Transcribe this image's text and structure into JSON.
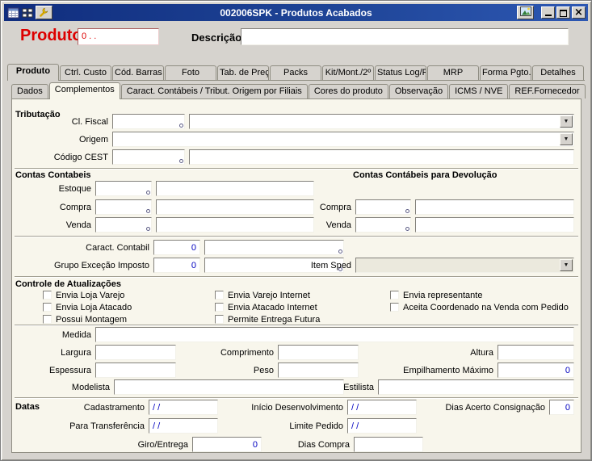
{
  "window": {
    "title": "002006SPK - Produtos Acabados"
  },
  "icons": {
    "close": "×",
    "dropdown_arrow": "▼"
  },
  "header": {
    "product_label": "Produto",
    "product_value": "0 . .",
    "description_label": "Descrição",
    "description_value": ""
  },
  "tabs_outer": [
    "Produto",
    "Ctrl. Custo",
    "Cód. Barras",
    "Foto",
    "Tab. de Preç",
    "Packs",
    "Kit/Mont./2º",
    "Status Log/F",
    "MRP",
    "Forma Pgto.",
    "Detalhes"
  ],
  "tabs_inner": [
    "Dados",
    "Complementos",
    "Caract. Contábeis / Tribut. Origem por Filiais",
    "Cores do produto",
    "Observação",
    "ICMS / NVE",
    "REF.Fornecedor"
  ],
  "tributacao": {
    "title": "Tributação",
    "cl_fiscal": {
      "label": "Cl. Fiscal",
      "code": "",
      "description": ""
    },
    "origem": {
      "label": "Origem",
      "value": ""
    },
    "codigo_cest": {
      "label": "Código CEST",
      "code": "",
      "description": ""
    }
  },
  "contas_contabeis": {
    "title": "Contas Contabeis",
    "estoque": {
      "label": "Estoque",
      "code": "",
      "description": ""
    },
    "compra": {
      "label": "Compra",
      "code": "",
      "description": ""
    },
    "venda": {
      "label": "Venda",
      "code": "",
      "description": ""
    }
  },
  "contas_devolucao": {
    "title": "Contas Contábeis para Devolução",
    "compra": {
      "label": "Compra",
      "code": "",
      "description": ""
    },
    "venda": {
      "label": "Venda",
      "code": "",
      "description": ""
    }
  },
  "caracteristicas": {
    "caract_contabil": {
      "label": "Caract. Contabil",
      "value": "0",
      "description": ""
    },
    "grupo_excecao": {
      "label": "Grupo Exceção Imposto",
      "value": "0",
      "description": ""
    },
    "item_sped": {
      "label": "Item Sped",
      "value": ""
    }
  },
  "controle": {
    "title": "Controle de Atualizações",
    "checkboxes": [
      {
        "label": "Envia Loja Varejo",
        "checked": false
      },
      {
        "label": "Envia Loja Atacado",
        "checked": false
      },
      {
        "label": "Possui Montagem",
        "checked": false
      },
      {
        "label": "Envia Varejo Internet",
        "checked": false
      },
      {
        "label": "Envia Atacado Internet",
        "checked": false
      },
      {
        "label": "Permite Entrega Futura",
        "checked": false
      },
      {
        "label": "Envia representante",
        "checked": false
      },
      {
        "label": "Aceita Coordenado na Venda com Pedido",
        "checked": false
      }
    ]
  },
  "medidas": {
    "medida": {
      "label": "Medida",
      "value": ""
    },
    "largura": {
      "label": "Largura",
      "value": ""
    },
    "comprimento": {
      "label": "Comprimento",
      "value": ""
    },
    "altura": {
      "label": "Altura",
      "value": ""
    },
    "espessura": {
      "label": "Espessura",
      "value": ""
    },
    "peso": {
      "label": "Peso",
      "value": ""
    },
    "empilhamento_maximo": {
      "label": "Empilhamento Máximo",
      "value": "0"
    },
    "modelista": {
      "label": "Modelista",
      "value": ""
    },
    "estilista": {
      "label": "Estilista",
      "value": ""
    }
  },
  "datas": {
    "title": "Datas",
    "cadastramento": {
      "label": "Cadastramento",
      "value": "/  /"
    },
    "inicio_desenvolvimento": {
      "label": "Início Desenvolvimento",
      "value": "/  /"
    },
    "dias_acerto_consignacao": {
      "label": "Dias Acerto Consignação",
      "value": "0"
    },
    "para_transferencia": {
      "label": "Para Transferência",
      "value": "/  /"
    },
    "limite_pedido": {
      "label": "Limite Pedido",
      "value": "/  /"
    },
    "giro_entrega": {
      "label": "Giro/Entrega",
      "value": "0"
    },
    "dias_compra": {
      "label": "Dias Compra",
      "value": ""
    }
  }
}
